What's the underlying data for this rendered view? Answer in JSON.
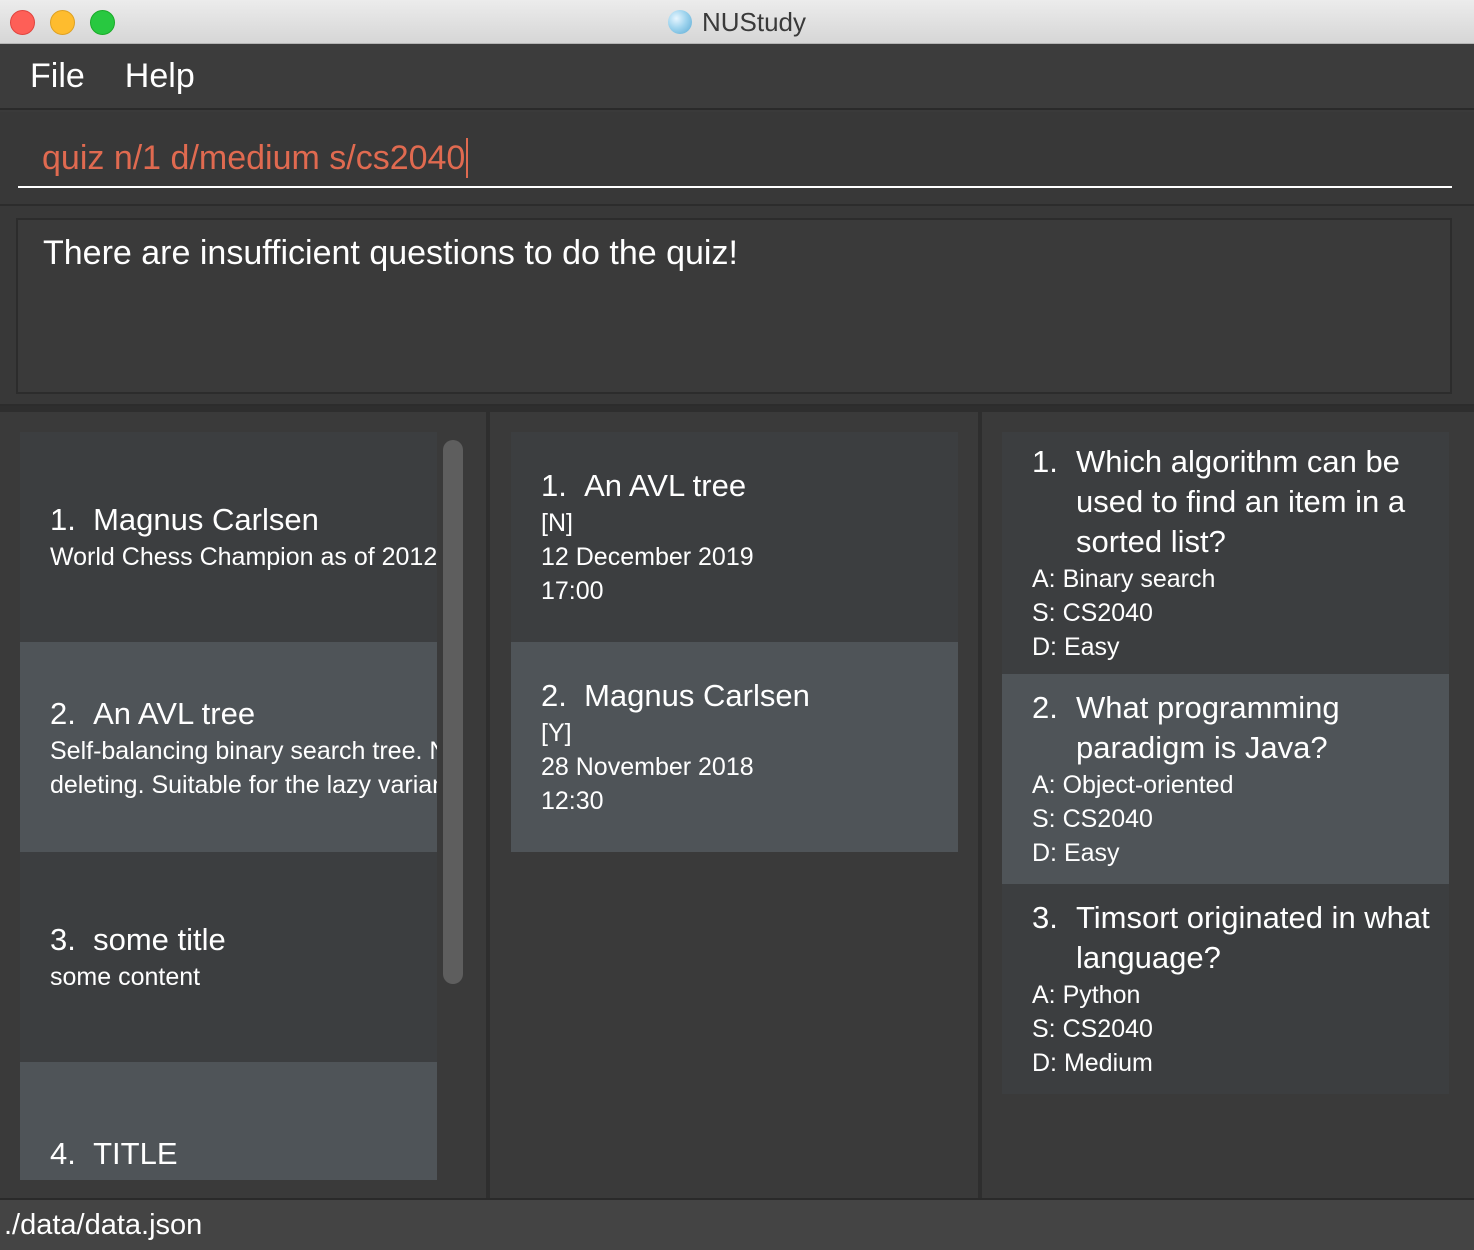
{
  "window": {
    "title": "NUStudy",
    "icon": "app-logo-icon"
  },
  "menu": {
    "items": [
      "File",
      "Help"
    ]
  },
  "command": {
    "value": "quiz n/1 d/medium s/cs2040",
    "text_color": "#e06a50"
  },
  "result": {
    "message": "There are insufficient questions to do the quiz!"
  },
  "notes": [
    {
      "index": "1.",
      "title": "Magnus Carlsen",
      "content": "World Chess Champion as of 2012"
    },
    {
      "index": "2.",
      "title": "An AVL tree",
      "content_line1": "Self-balancing binary search tree. N",
      "content_line2": "deleting. Suitable for the lazy variant"
    },
    {
      "index": "3.",
      "title": "some title",
      "content": "some content"
    },
    {
      "index": "4.",
      "title": "TITLE"
    }
  ],
  "revision": [
    {
      "index": "1.",
      "title": "An AVL tree",
      "flag": "[N]",
      "date": "12 December 2019",
      "time": "17:00"
    },
    {
      "index": "2.",
      "title": "Magnus Carlsen",
      "flag": "[Y]",
      "date": "28 November 2018",
      "time": "12:30"
    }
  ],
  "questions": [
    {
      "index": "1.",
      "question": "Which algorithm can be used to find an item in a sorted list?",
      "answer": "A: Binary search",
      "subject": "S: CS2040",
      "difficulty": "D: Easy"
    },
    {
      "index": "2.",
      "question": "What programming paradigm is Java?",
      "answer": "A: Object-oriented",
      "subject": "S: CS2040",
      "difficulty": "D: Easy"
    },
    {
      "index": "3.",
      "question": "Timsort originated in what language?",
      "answer": "A: Python",
      "subject": "S: CS2040",
      "difficulty": "D: Medium"
    }
  ],
  "status": {
    "path": "./data/data.json"
  },
  "colors": {
    "card_dark": "#3c3e40",
    "card_light": "#4f5458",
    "background": "#3a3a3a"
  }
}
